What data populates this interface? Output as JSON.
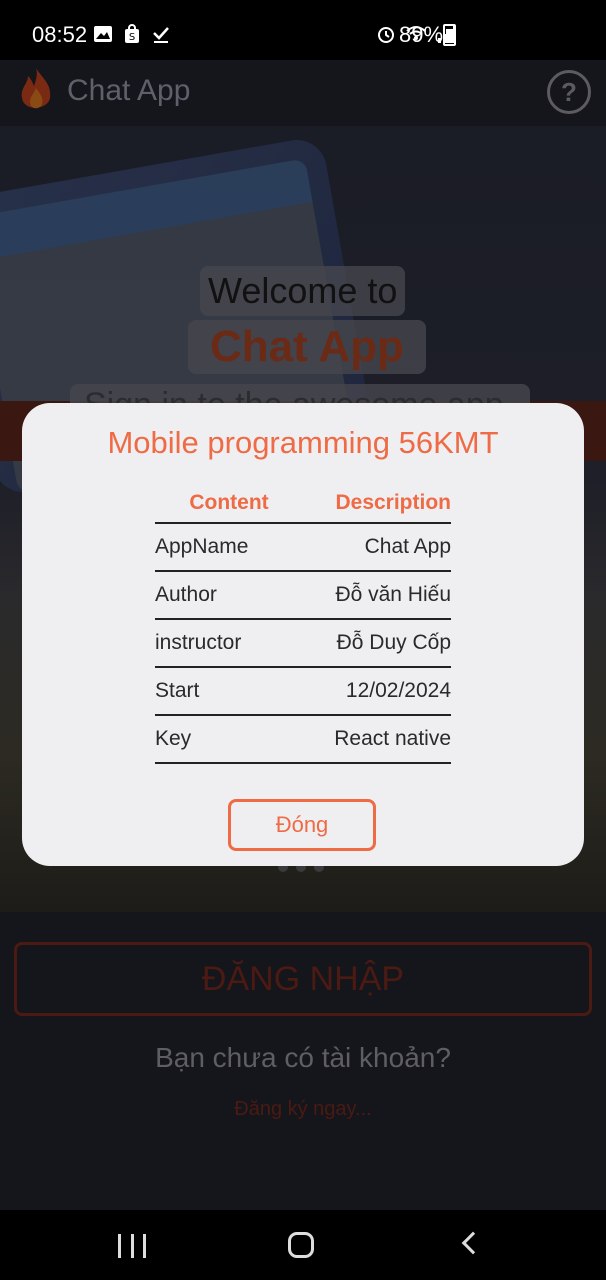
{
  "status_bar": {
    "time": "08:52",
    "battery": "89%",
    "left_icons": [
      "image-icon",
      "shopping-bag-icon",
      "download-done-icon"
    ],
    "right_icons": [
      "alarm-icon",
      "wifi-icon",
      "signal-icon",
      "battery-charging-icon"
    ]
  },
  "app": {
    "title": "Chat App",
    "logo_icon": "flame-icon",
    "help_icon": "help-icon",
    "help_label": "?"
  },
  "hero": {
    "welcome": "Welcome to",
    "brand": "Chat App",
    "tagline": "Sign in to the awesome app"
  },
  "login": {
    "button": "ĐĂNG NHẬP",
    "no_account": "Bạn chưa có tài khoản?",
    "register": "Đăng ký ngay..."
  },
  "modal": {
    "title": "Mobile programming 56KMT",
    "headers": [
      "Content",
      "Description"
    ],
    "rows": [
      [
        "AppName",
        "Chat App"
      ],
      [
        "Author",
        "Đỗ văn Hiếu"
      ],
      [
        "instructor",
        "Đỗ Duy Cốp"
      ],
      [
        "Start",
        "12/02/2024"
      ],
      [
        "Key",
        "React native"
      ]
    ],
    "close_label": "Đóng"
  },
  "colors": {
    "accent": "#ee6b45",
    "modal_bg": "#efeff1"
  }
}
